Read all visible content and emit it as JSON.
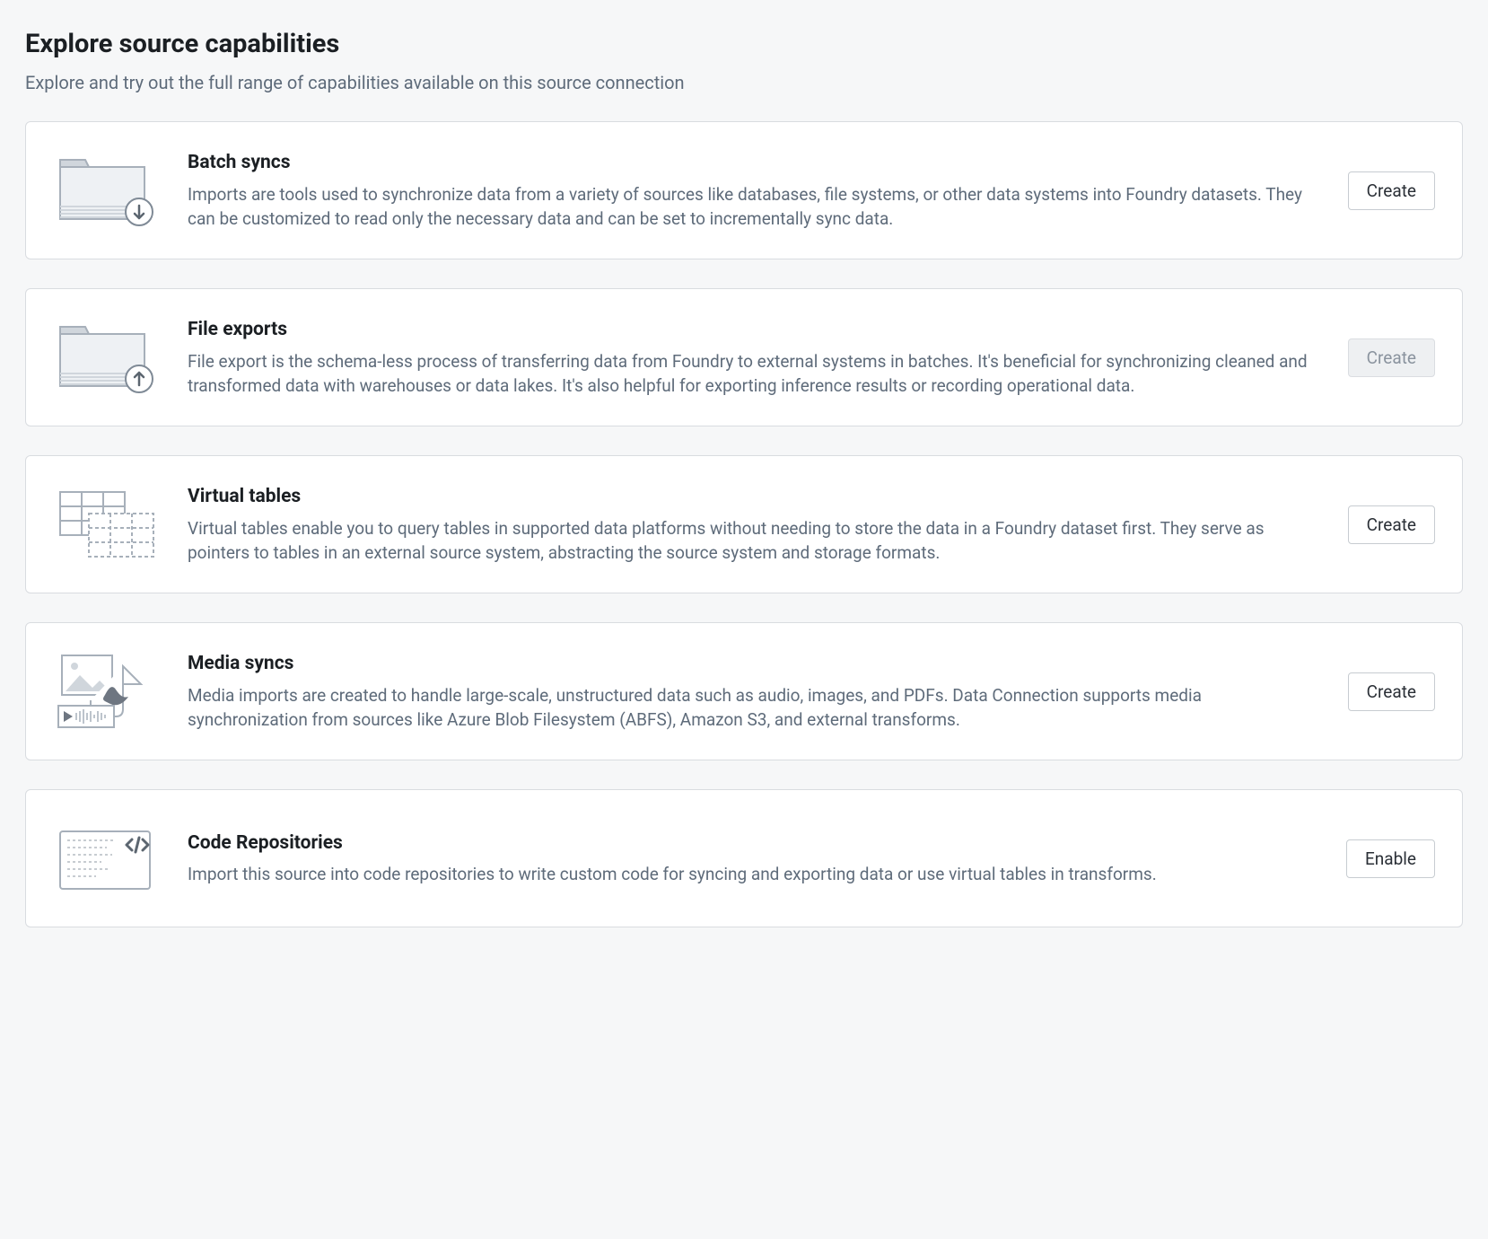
{
  "header": {
    "title": "Explore source capabilities",
    "subtitle": "Explore and try out the full range of capabilities available on this source connection"
  },
  "capabilities": [
    {
      "icon": "folder-down-icon",
      "title": "Batch syncs",
      "description": "Imports are tools used to synchronize data from a variety of sources like databases, file systems, or other data systems into Foundry datasets. They can be customized to read only the necessary data and can be set to incrementally sync data.",
      "action_label": "Create",
      "action_disabled": false
    },
    {
      "icon": "folder-up-icon",
      "title": "File exports",
      "description": "File export is the schema-less process of transferring data from Foundry to external systems in batches. It's beneficial for synchronizing cleaned and transformed data with warehouses or data lakes. It's also helpful for exporting inference results or recording operational data.",
      "action_label": "Create",
      "action_disabled": true
    },
    {
      "icon": "virtual-tables-icon",
      "title": "Virtual tables",
      "description": "Virtual tables enable you to query tables in supported data platforms without needing to store the data in a Foundry dataset first. They serve as pointers to tables in an external source system, abstracting the source system and storage formats.",
      "action_label": "Create",
      "action_disabled": false
    },
    {
      "icon": "media-syncs-icon",
      "title": "Media syncs",
      "description": "Media imports are created to handle large-scale, unstructured data such as audio, images, and PDFs. Data Connection supports media synchronization from sources like Azure Blob Filesystem (ABFS), Amazon S3, and external transforms.",
      "action_label": "Create",
      "action_disabled": false
    },
    {
      "icon": "code-repo-icon",
      "title": "Code Repositories",
      "description": "Import this source into code repositories to write custom code for syncing and exporting data or use virtual tables in transforms.",
      "action_label": "Enable",
      "action_disabled": false
    }
  ]
}
